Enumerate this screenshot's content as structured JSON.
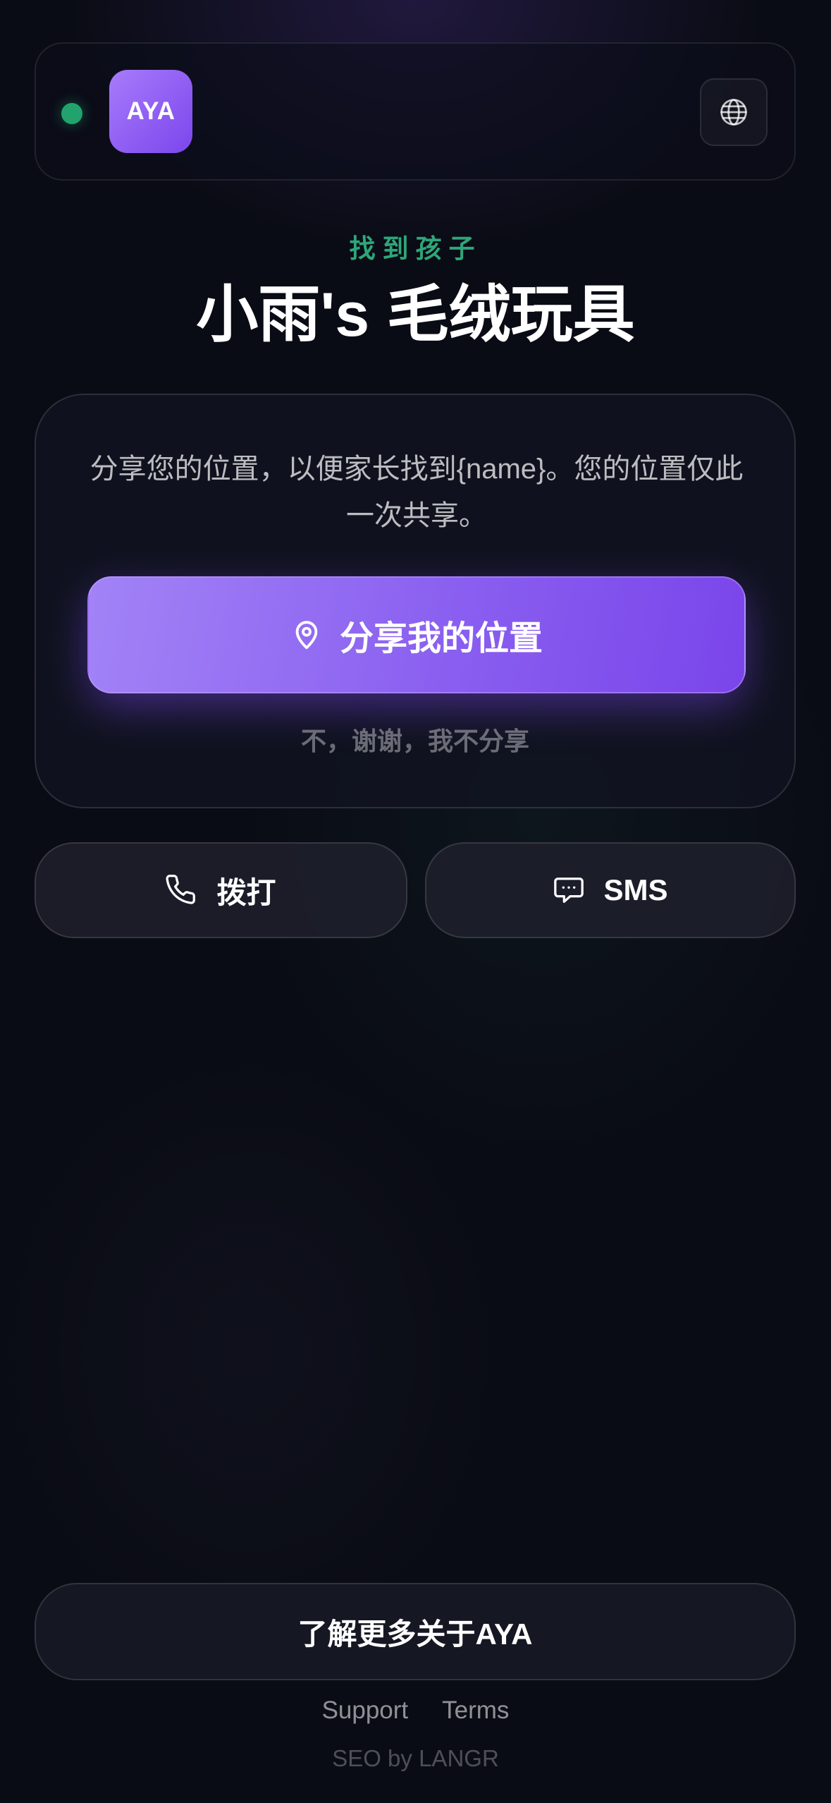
{
  "header": {
    "logo_text": "AYA",
    "status": "online",
    "globe_icon": "globe-icon"
  },
  "hero": {
    "eyebrow": "找到孩子",
    "title": "小雨's 毛绒玩具"
  },
  "share_card": {
    "message": "分享您的位置，以便家长找到{name}。您的位置仅此一次共享。",
    "share_button_label": "分享我的位置",
    "share_icon": "location-pin-icon",
    "decline_label": "不，谢谢，我不分享"
  },
  "actions": {
    "call_label": "拨打",
    "call_icon": "phone-icon",
    "sms_label": "SMS",
    "sms_icon": "chat-bubble-icon"
  },
  "footer": {
    "learn_more_label": "了解更多关于AYA",
    "links": [
      {
        "label": "Support"
      },
      {
        "label": "Terms"
      }
    ],
    "seo_text": "SEO by LANGR"
  },
  "colors": {
    "accent_purple": "#8a5ff0",
    "status_green": "#22a36d",
    "eyebrow_green": "#2ea67a",
    "background": "#0a0c15"
  }
}
